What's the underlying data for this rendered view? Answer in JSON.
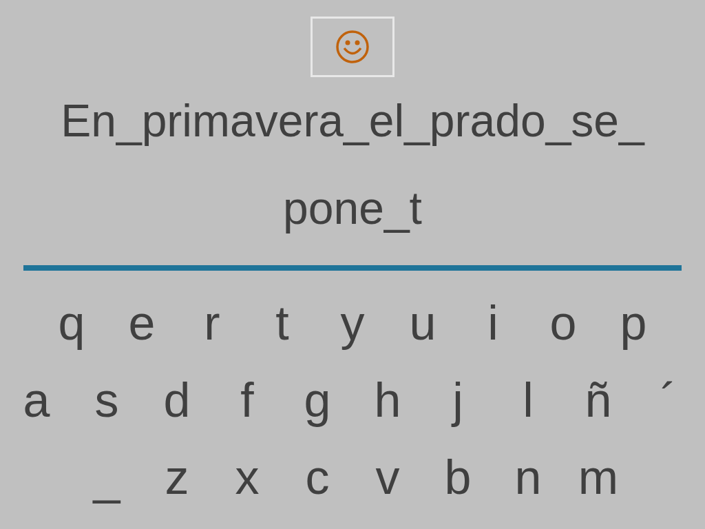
{
  "phrase_lines": [
    "En_primavera_el_prado_se_",
    "pone_t"
  ],
  "keyboard": {
    "rows": [
      [
        "q",
        "e",
        "r",
        "t",
        "y",
        "u",
        "i",
        "o",
        "p"
      ],
      [
        "a",
        "s",
        "d",
        "f",
        "g",
        "h",
        "j",
        "l",
        "ñ",
        "´"
      ],
      [
        "_",
        "z",
        "x",
        "c",
        "v",
        "b",
        "n",
        "m"
      ]
    ]
  }
}
